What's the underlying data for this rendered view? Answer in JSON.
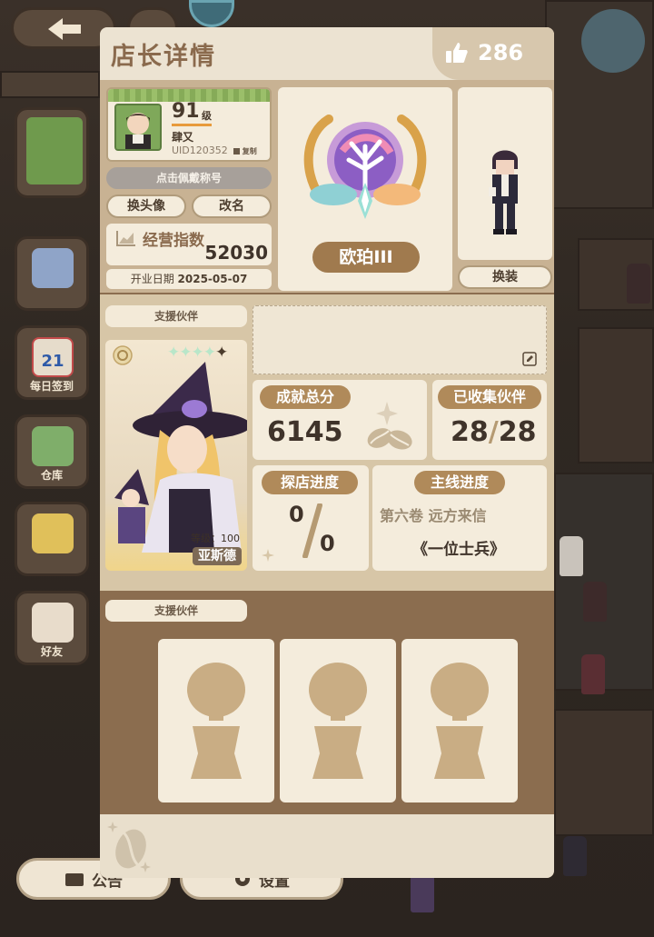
{
  "modal": {
    "title": "店长详情",
    "likes": "286"
  },
  "profile": {
    "level": "91",
    "level_unit": "级",
    "nickname": "肆又",
    "uid": "UID120352",
    "copy_label": "复制",
    "title_placeholder": "点击佩戴称号",
    "change_avatar": "换头像",
    "rename": "改名",
    "business_label": "经营指数",
    "business_value": "52030",
    "open_date_label": "开业日期",
    "open_date": "2025-05-07"
  },
  "rank": {
    "name": "欧珀III"
  },
  "outfit": {
    "change_label": "换装"
  },
  "support": {
    "tab_label": "支援伙伴",
    "partner_level_label": "等级：",
    "partner_level": "100",
    "partner_name": "亚斯德",
    "partner_stars": 4
  },
  "stats": {
    "achievement_label": "成就总分",
    "achievement_value": "6145",
    "collected_label": "已收集伙伴",
    "collected_have": "28",
    "collected_sep": "/",
    "collected_total": "28",
    "explore_label": "探店进度",
    "explore_have": "0",
    "explore_total": "0",
    "main_label": "主线进度",
    "main_volume": "第六卷 远方来信",
    "main_chapter": "《一位士兵》"
  },
  "support2": {
    "tab_label": "支援伙伴"
  },
  "background": {
    "daily_checkin": "每日签到",
    "warehouse": "仓库",
    "friends": "好友",
    "announcement": "公告",
    "settings": "设置",
    "calendar_day": "21"
  },
  "colors": {
    "panel": "#8b6d4f",
    "card": "#f4ecdc",
    "tag": "#b08a5a",
    "header_text": "#8a6a4d"
  }
}
